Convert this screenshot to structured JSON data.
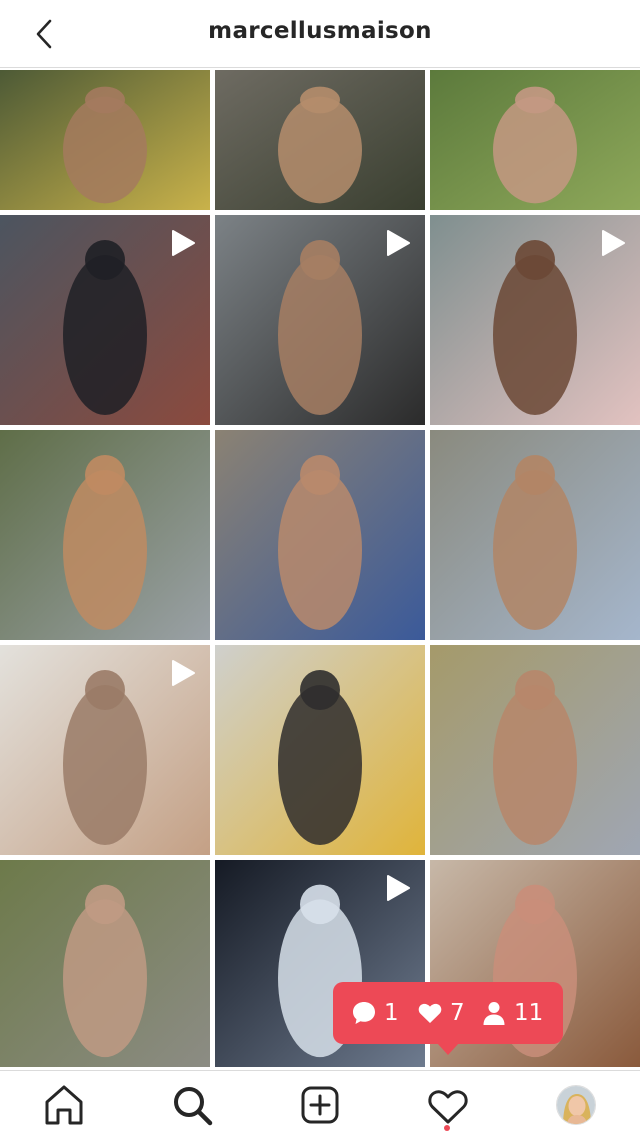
{
  "header": {
    "title": "marcellusmaison",
    "back_icon": "chevron-left-icon"
  },
  "grid": {
    "posts": [
      {
        "id": "post-1",
        "video": false,
        "colors": [
          "#4d5a36",
          "#c9b24a",
          "#a47a5e"
        ]
      },
      {
        "id": "post-2",
        "video": false,
        "colors": [
          "#6e6b62",
          "#3a3f30",
          "#b58d6c"
        ]
      },
      {
        "id": "post-3",
        "video": false,
        "colors": [
          "#5c7a3c",
          "#8ea85a",
          "#c49883"
        ]
      },
      {
        "id": "post-4",
        "video": true,
        "colors": [
          "#4c5560",
          "#8b4a3e",
          "#1f2026"
        ]
      },
      {
        "id": "post-5",
        "video": true,
        "colors": [
          "#7c8286",
          "#2b2b2b",
          "#a67e63"
        ]
      },
      {
        "id": "post-6",
        "video": true,
        "colors": [
          "#7f8f8f",
          "#e2c2c0",
          "#6b4835"
        ]
      },
      {
        "id": "post-7",
        "video": false,
        "colors": [
          "#5f6e48",
          "#9aa1a6",
          "#c08b62"
        ]
      },
      {
        "id": "post-8",
        "video": false,
        "colors": [
          "#8b8273",
          "#3b5a9a",
          "#b98a6c"
        ]
      },
      {
        "id": "post-9",
        "video": false,
        "colors": [
          "#8a8a7e",
          "#a5b6cc",
          "#b28565"
        ]
      },
      {
        "id": "post-10",
        "video": true,
        "colors": [
          "#e3e1dc",
          "#c4a085",
          "#9a7b67"
        ]
      },
      {
        "id": "post-11",
        "video": false,
        "colors": [
          "#cfd0cd",
          "#e0b43a",
          "#2f2d2d"
        ]
      },
      {
        "id": "post-12",
        "video": false,
        "colors": [
          "#a59a6a",
          "#9fa6b3",
          "#b7866a"
        ]
      },
      {
        "id": "post-13",
        "video": false,
        "colors": [
          "#6d7a4a",
          "#8c8c84",
          "#c09a84"
        ]
      },
      {
        "id": "post-14",
        "video": true,
        "colors": [
          "#151a24",
          "#6e7b8f",
          "#d7e0ea"
        ]
      },
      {
        "id": "post-15",
        "video": false,
        "colors": [
          "#c7b8a8",
          "#8a5a3c",
          "#c98e7a"
        ]
      }
    ],
    "play_icon": "play-icon"
  },
  "activity": {
    "comments_count": "1",
    "likes_count": "7",
    "followers_count": "11",
    "background": "#ed4956",
    "icons": [
      "comment-icon",
      "heart-icon",
      "person-icon"
    ]
  },
  "nav": {
    "items": [
      "home-icon",
      "search-icon",
      "add-post-icon",
      "activity-heart-icon",
      "profile-avatar"
    ],
    "notification_dot_color": "#ed4956"
  }
}
